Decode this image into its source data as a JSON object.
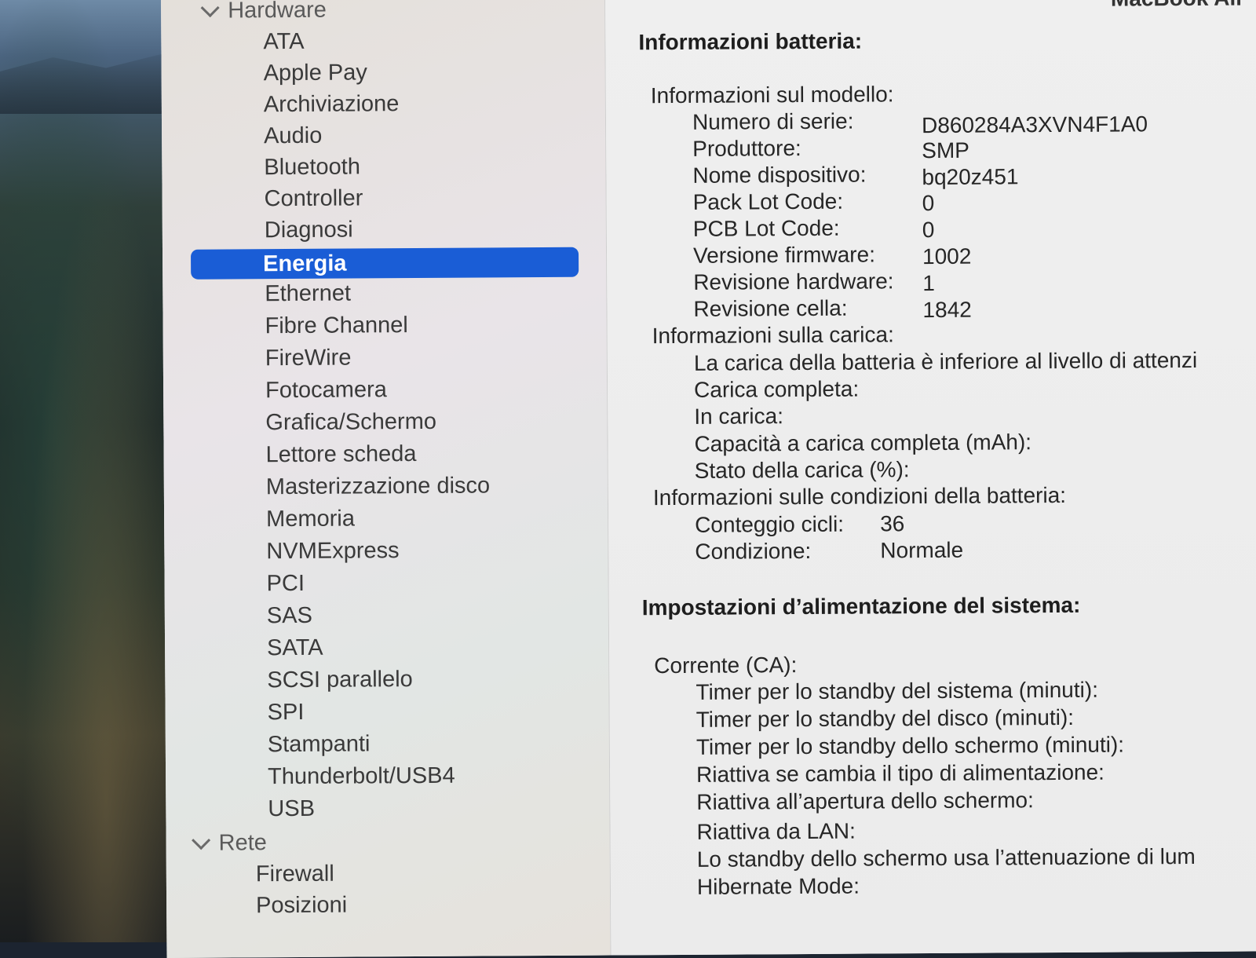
{
  "window_title": "MacBook Air",
  "sidebar": {
    "hardware_label": "Hardware",
    "items": [
      "ATA",
      "Apple Pay",
      "Archiviazione",
      "Audio",
      "Bluetooth",
      "Controller",
      "Diagnosi",
      "Energia",
      "Ethernet",
      "Fibre Channel",
      "FireWire",
      "Fotocamera",
      "Grafica/Schermo",
      "Lettore scheda",
      "Masterizzazione disco",
      "Memoria",
      "NVMExpress",
      "PCI",
      "SAS",
      "SATA",
      "SCSI parallelo",
      "SPI",
      "Stampanti",
      "Thunderbolt/USB4",
      "USB"
    ],
    "selected": "Energia",
    "rete_label": "Rete",
    "rete_items": [
      "Firewall",
      "Posizioni"
    ]
  },
  "battery": {
    "title": "Informazioni batteria:",
    "model_group": "Informazioni sul modello:",
    "serial_label": "Numero di serie:",
    "serial": "D860284A3XVN4F1A0",
    "maker_label": "Produttore:",
    "maker": "SMP",
    "device_label": "Nome dispositivo:",
    "device": "bq20z451",
    "pack_label": "Pack Lot Code:",
    "pack": "0",
    "pcb_label": "PCB Lot Code:",
    "pcb": "0",
    "fw_label": "Versione firmware:",
    "fw": "1002",
    "hw_label": "Revisione hardware:",
    "hw": "1",
    "cell_label": "Revisione cella:",
    "cell": "1842",
    "charge_group": "Informazioni sulla carica:",
    "charge_warning": "La carica della batteria è inferiore al livello di attenzi",
    "full_label": "Carica completa:",
    "charging_label": "In carica:",
    "capacity_label": "Capacità a carica completa (mAh):",
    "state_label": "Stato della carica (%):",
    "condition_group": "Informazioni sulle condizioni della batteria:",
    "cycles_label": "Conteggio cicli:",
    "cycles": "36",
    "condition_label": "Condizione:",
    "condition": "Normale"
  },
  "power": {
    "title": "Impostazioni d’alimentazione del sistema:",
    "ac_group": "Corrente (CA):",
    "rows": [
      "Timer per lo standby del sistema (minuti):",
      "Timer per lo standby del disco (minuti):",
      "Timer per lo standby dello schermo (minuti):",
      "Riattiva se cambia il tipo di alimentazione:",
      "Riattiva all’apertura dello schermo:",
      "Riattiva da LAN:",
      "Lo standby dello schermo usa l’attenuazione di lum",
      "Hibernate Mode:"
    ]
  }
}
